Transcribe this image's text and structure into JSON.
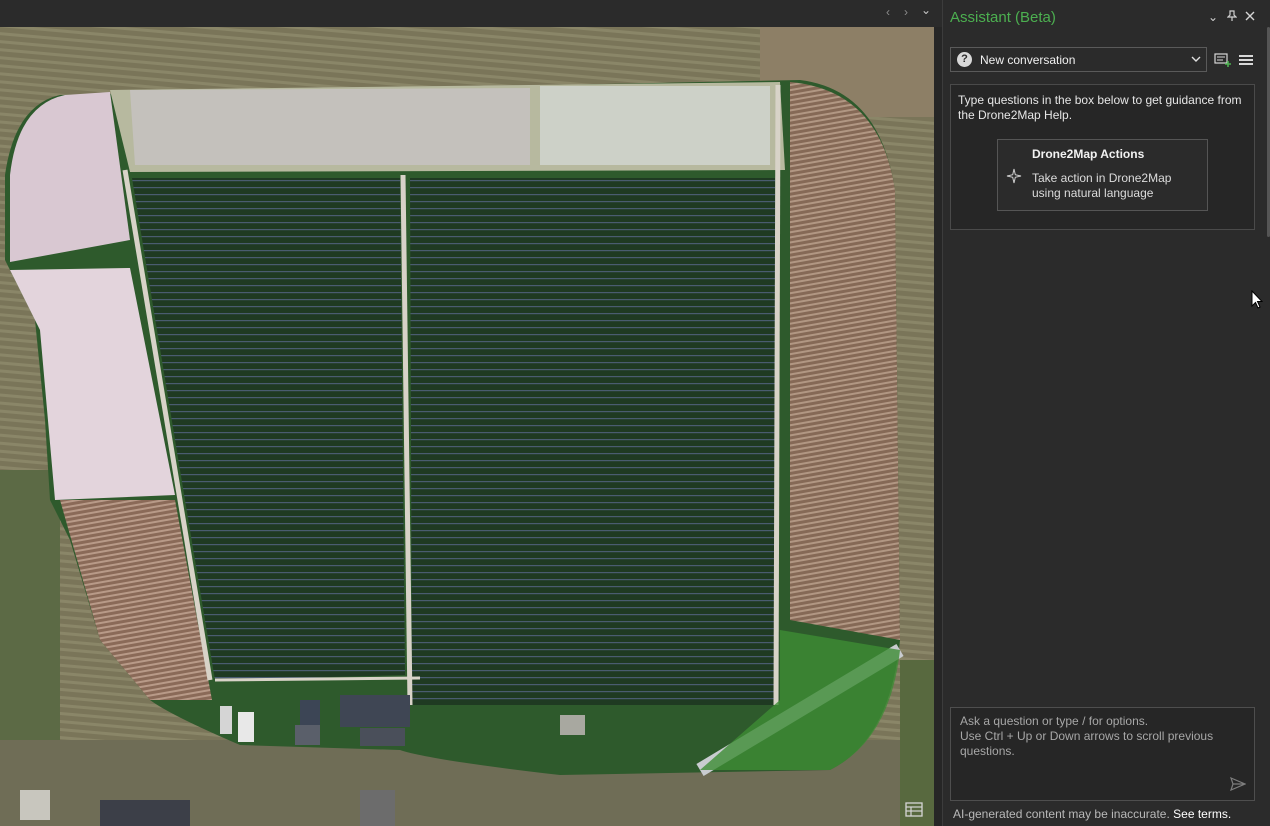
{
  "topbar": {
    "nav_prev": "‹",
    "nav_next": "›",
    "nav_menu": "⌄"
  },
  "map": {
    "description_icons": [
      "table-view-icon"
    ]
  },
  "assistant": {
    "title": "Assistant (Beta)",
    "title_color": "#4caf50",
    "conversation_select": "New conversation",
    "guidance_text": "Type questions in the box below to get guidance from the Drone2Map Help.",
    "action_card": {
      "title": "Drone2Map Actions",
      "description": "Take action in Drone2Map using natural language"
    },
    "input_placeholder": "Ask a question or type / for options.\nUse Ctrl + Up or Down arrows to scroll previous questions.",
    "disclaimer": "AI-generated content may be inaccurate.",
    "see_terms": "See terms."
  },
  "colors": {
    "accent": "#4caf50",
    "panel_bg": "#2b2b2b",
    "text": "#e8e8e8"
  }
}
